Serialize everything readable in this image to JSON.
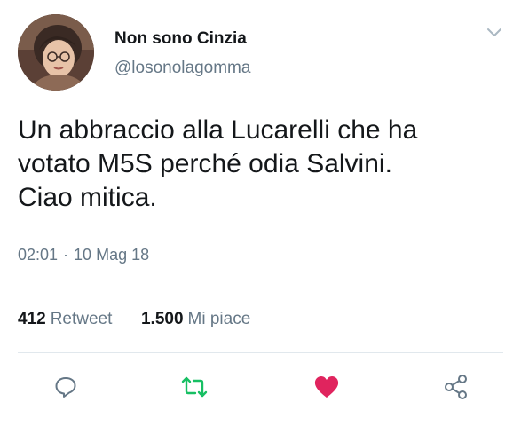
{
  "user": {
    "display_name": "Non sono Cinzia",
    "handle": "@losonolagomma"
  },
  "tweet": {
    "text_lines": [
      "Un abbraccio alla Lucarelli che ha",
      "votato M5S perché odia Salvini.",
      "Ciao mitica."
    ],
    "time": "02:01",
    "separator": "·",
    "date": "10 Mag 18"
  },
  "stats": {
    "retweets_count": "412",
    "retweets_label": "Retweet",
    "likes_count": "1.500",
    "likes_label": "Mi piace"
  },
  "icons": {
    "menu": "chevron-down-icon",
    "reply": "reply-icon",
    "retweet": "retweet-icon",
    "like": "heart-icon",
    "share": "share-icon"
  },
  "colors": {
    "retweet": "#17bf63",
    "like": "#e0245e",
    "muted": "#657786",
    "text": "#14171a"
  }
}
